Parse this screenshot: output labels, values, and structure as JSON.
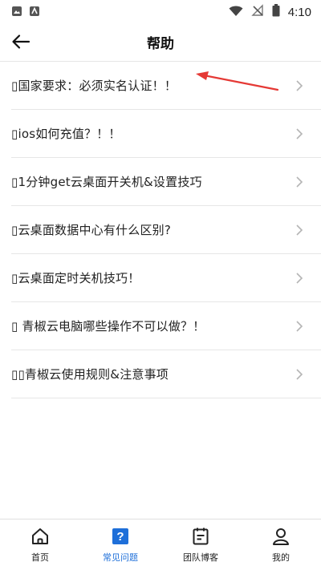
{
  "status_bar": {
    "time": "4:10",
    "left_icons": [
      "image-icon",
      "android-icon"
    ],
    "right_icons": [
      "wifi-icon",
      "signal-off-icon",
      "battery-icon"
    ]
  },
  "header": {
    "title": "帮助",
    "back_icon": "arrow-left-icon"
  },
  "help_items": [
    {
      "label": "▯国家要求：必须实名认证！！"
    },
    {
      "label": "▯ios如何充值？！！"
    },
    {
      "label": "▯1分钟get云桌面开关机&设置技巧"
    },
    {
      "label": "▯云桌面数据中心有什么区别?"
    },
    {
      "label": "▯云桌面定时关机技巧！"
    },
    {
      "label": "▯ 青椒云电脑哪些操作不可以做？！"
    },
    {
      "label": "▯▯青椒云使用规则&注意事项"
    }
  ],
  "annotation": {
    "arrow_color": "#e53935"
  },
  "bottom_nav": [
    {
      "label": "首页",
      "icon": "home-icon"
    },
    {
      "label": "常见问题",
      "icon": "question-icon",
      "active": true
    },
    {
      "label": "团队博客",
      "icon": "blog-icon"
    },
    {
      "label": "我的",
      "icon": "person-icon"
    }
  ],
  "colors": {
    "accent": "#1e6fd9",
    "divider": "#e6e6e6",
    "text": "#222222"
  }
}
